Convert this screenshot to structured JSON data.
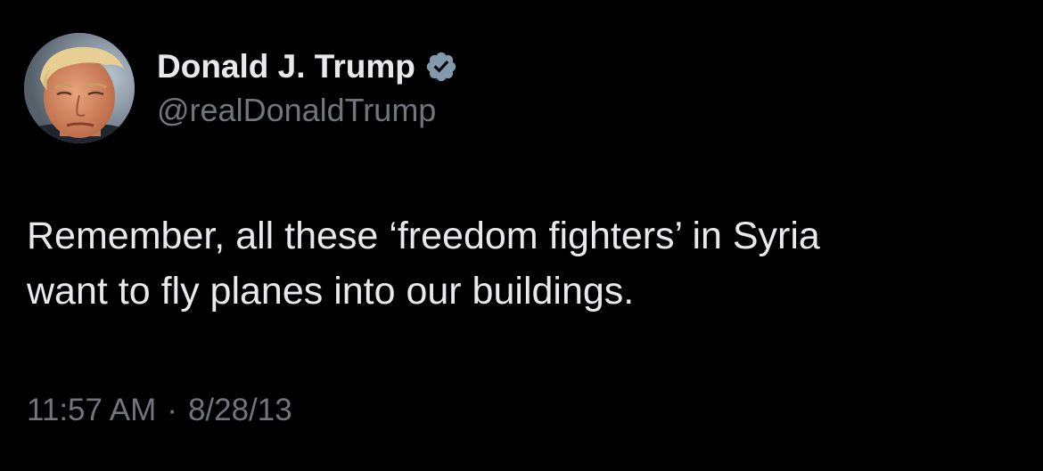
{
  "author": {
    "display_name": "Donald J. Trump",
    "handle": "@realDonaldTrump",
    "verified": true,
    "verified_icon": "verified-badge-icon",
    "verified_color": "#829aab"
  },
  "tweet": {
    "text_lines": [
      "Remember, all these ‘freedom fighters’ in Syria",
      "want to fly planes into our buildings."
    ],
    "time": "11:57 AM",
    "separator": "·",
    "date": "8/28/13"
  },
  "theme": {
    "background": "#000000",
    "text": "#e7e9ea",
    "secondary_text": "#71767b"
  }
}
